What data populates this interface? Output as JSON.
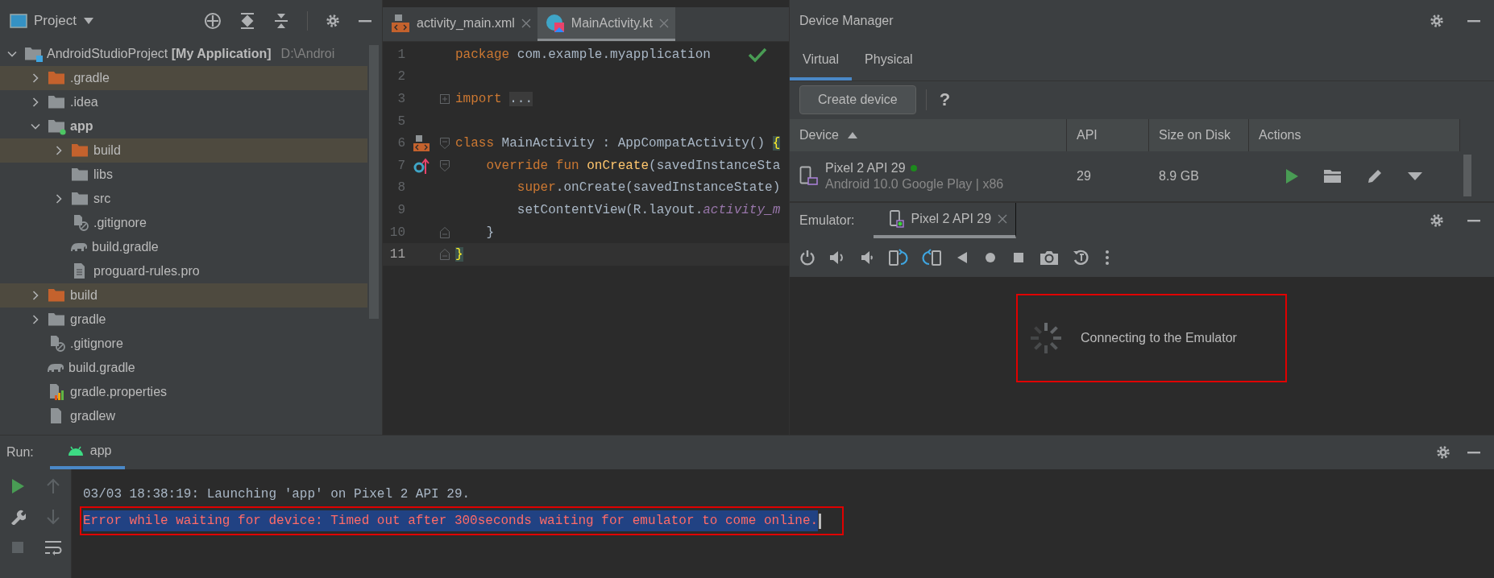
{
  "project_panel": {
    "title": "Project",
    "tree": [
      {
        "label": "AndroidStudioProject **[My Application]**",
        "path": "D:\\Androi",
        "kind": "project",
        "expanded": true,
        "excluded": false,
        "children": [
          {
            "label": ".gradle",
            "kind": "folder",
            "expanded": false,
            "excluded": true
          },
          {
            "label": ".idea",
            "kind": "folder",
            "expanded": false,
            "excluded": false
          },
          {
            "label": "app",
            "kind": "module",
            "expanded": true,
            "excluded": false,
            "children": [
              {
                "label": "build",
                "kind": "folder",
                "expanded": false,
                "excluded": true
              },
              {
                "label": "libs",
                "kind": "folder",
                "excluded": false
              },
              {
                "label": "src",
                "kind": "folder",
                "expanded": false,
                "excluded": false
              },
              {
                "label": ".gitignore",
                "kind": "gitignore",
                "excluded": false
              },
              {
                "label": "build.gradle",
                "kind": "gradle",
                "excluded": false
              },
              {
                "label": "proguard-rules.pro",
                "kind": "text",
                "excluded": false
              }
            ]
          },
          {
            "label": "build",
            "kind": "folder",
            "expanded": false,
            "excluded": true
          },
          {
            "label": "gradle",
            "kind": "folder",
            "expanded": false,
            "excluded": false
          },
          {
            "label": ".gitignore",
            "kind": "gitignore",
            "excluded": false
          },
          {
            "label": "build.gradle",
            "kind": "gradle",
            "excluded": false
          },
          {
            "label": "gradle.properties",
            "kind": "properties",
            "excluded": false
          },
          {
            "label": "gradlew",
            "kind": "script",
            "excluded": false
          }
        ]
      }
    ]
  },
  "editor": {
    "tabs": [
      {
        "label": "activity_main.xml",
        "kind": "xml",
        "selected": false
      },
      {
        "label": "MainActivity.kt",
        "kind": "kotlin",
        "selected": true
      }
    ],
    "lines": [
      {
        "number": "1",
        "current": false,
        "segments": [
          {
            "text": "package",
            "kind": "keyword"
          },
          {
            "text": " com.example.myapplication",
            "kind": "plain"
          }
        ]
      },
      {
        "number": "2",
        "current": false
      },
      {
        "number": "3",
        "current": false,
        "gutter": [
          {
            "kind": "fold-collapsed"
          }
        ],
        "segments": [
          {
            "text": "import",
            "kind": "keyword"
          },
          {
            "text": "...",
            "kind": "folded"
          }
        ]
      },
      {
        "number": "5",
        "current": false
      },
      {
        "number": "6",
        "current": false,
        "gutter": [
          {
            "kind": "layout"
          },
          {
            "kind": "fold-start"
          }
        ],
        "segments": [
          {
            "text": "class",
            "kind": "keyword"
          },
          {
            "text": " MainActivity : AppCompatActivity() ",
            "kind": "plain"
          },
          {
            "text": "{",
            "kind": "brace"
          }
        ]
      },
      {
        "number": "7",
        "current": false,
        "gutter": [
          {
            "kind": "override"
          },
          {
            "kind": "fold-start"
          }
        ],
        "segments": [
          {
            "text": "    override fun ",
            "kind": "keyword"
          },
          {
            "text": "onCreate",
            "kind": "function"
          },
          {
            "text": "(savedInstanceSta",
            "kind": "plain"
          }
        ]
      },
      {
        "number": "8",
        "current": false,
        "segments": [
          {
            "text": "        super",
            "kind": "keyword"
          },
          {
            "text": ".onCreate(savedInstanceState)",
            "kind": "plain"
          }
        ]
      },
      {
        "number": "9",
        "current": false,
        "segments": [
          {
            "text": "        setContentView(R.layout.",
            "kind": "plain"
          },
          {
            "text": "activity_m",
            "kind": "field"
          }
        ]
      },
      {
        "number": "10",
        "current": false,
        "gutter": [
          {
            "kind": "fold-end"
          }
        ],
        "segments": [
          {
            "text": "    }",
            "kind": "plain"
          }
        ]
      },
      {
        "number": "11",
        "current": true,
        "gutter": [
          {
            "kind": "fold-end"
          }
        ],
        "segments": [
          {
            "text": "}",
            "kind": "brace"
          }
        ]
      }
    ]
  },
  "device_manager": {
    "title": "Device Manager",
    "tabs": [
      {
        "label": "Virtual",
        "selected": true
      },
      {
        "label": "Physical",
        "selected": false
      }
    ],
    "create_button": "Create device",
    "help": "?",
    "table": {
      "columns": [
        {
          "label": "Device",
          "sort_ascending": true
        },
        {
          "label": "API"
        },
        {
          "label": "Size on Disk"
        },
        {
          "label": "Actions"
        }
      ],
      "rows": [
        {
          "name": "Pixel 2 API 29",
          "online": true,
          "details": "Android 10.0 Google Play | x86",
          "api": "29",
          "size": "8.9 GB"
        }
      ]
    }
  },
  "emulator": {
    "label": "Emulator:",
    "tabs": [
      {
        "label": "Pixel 2 API 29",
        "selected": true
      }
    ],
    "status": "Connecting to the Emulator",
    "highlighted": true
  },
  "run_panel": {
    "label": "Run:",
    "tabs": [
      {
        "label": "app",
        "selected": true
      }
    ],
    "toolbar": [
      {
        "kind": "run",
        "disabled": false
      },
      {
        "kind": "up",
        "disabled": true
      },
      {
        "kind": "wrench",
        "disabled": false
      },
      {
        "kind": "down",
        "disabled": true
      },
      {
        "kind": "stop",
        "disabled": true
      },
      {
        "kind": "wrap",
        "disabled": false
      }
    ],
    "console": [
      {
        "text": "03/03 18:38:19: Launching 'app' on Pixel 2 API 29.",
        "kind": "info",
        "selected": false,
        "highlighted": false
      },
      {
        "text": "Error while waiting for device: Timed out after 300seconds waiting for emulator to come online.",
        "kind": "error",
        "selected": true,
        "highlighted": true
      }
    ]
  }
}
